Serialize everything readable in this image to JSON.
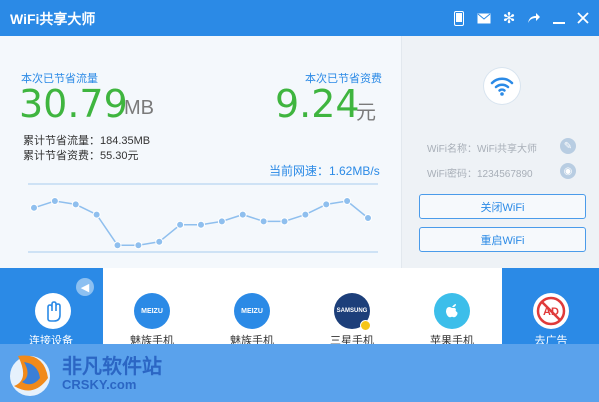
{
  "window": {
    "title": "WiFi共享大师",
    "icons": [
      "phone-icon",
      "mail-icon",
      "gear-icon",
      "share-icon",
      "minimize-icon",
      "close-icon"
    ]
  },
  "stats": {
    "traffic_label": "本次已节省流量",
    "traffic_value": "30.79",
    "traffic_unit": "MB",
    "cost_label": "本次已节省资费",
    "cost_value": "9.24",
    "cost_unit": "元",
    "total_traffic": "累计节省流量：184.35MB",
    "total_cost": "累计节省资费：55.30元",
    "speed": "当前网速：1.62MB/s"
  },
  "speed_chart": {
    "type": "line",
    "values": [
      4,
      5,
      4.5,
      3,
      -1.5,
      -1.5,
      -1,
      1.5,
      1.5,
      2,
      3,
      2,
      2,
      3,
      4.5,
      5,
      2.5
    ],
    "ylim": [
      -2.5,
      7.5
    ],
    "colors": {
      "line": "#8fbfee",
      "point": "#8fbfee",
      "axis": "#a9cbee"
    }
  },
  "wifi_panel": {
    "name": "WiFi名称：WiFi共享大师",
    "password": "WiFi密码：1234567890",
    "close_btn": "关闭WiFi",
    "restart_btn": "重启WiFi"
  },
  "devices": {
    "left_label": "连接设备",
    "items": [
      {
        "label": "魅族手机",
        "icon_text": "MEIZU",
        "color": "#2b8ae6"
      },
      {
        "label": "魅族手机",
        "icon_text": "MEIZU",
        "color": "#2b8ae6"
      },
      {
        "label": "三星手机",
        "icon_text": "SAMSUNG",
        "color": "#1d3f7a"
      },
      {
        "label": "苹果手机",
        "icon_text": "",
        "color": "#3cbeea"
      }
    ],
    "right_label": "去广告",
    "ad_icon_text": "AD"
  },
  "watermark": {
    "text": "非凡软件站",
    "url": "CRSKY.com"
  },
  "colors": {
    "accent": "#2b8ae6",
    "green": "#3fb53f"
  }
}
